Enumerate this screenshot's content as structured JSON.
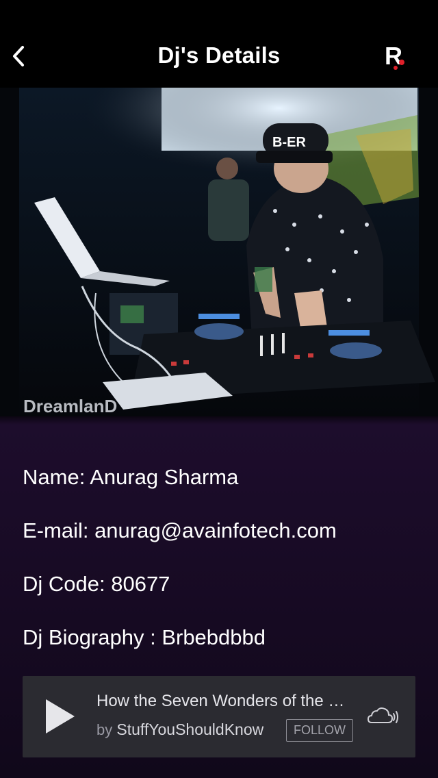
{
  "header": {
    "title": "Dj's Details",
    "back_icon": "chevron-left-icon",
    "logo_icon": "r-logo-icon",
    "logo_letter": "R"
  },
  "photo": {
    "watermark": "DreamlanD",
    "cap_text": "B-ER"
  },
  "details": {
    "name": "Name: Anurag Sharma",
    "email": "E-mail: anurag@avainfotech.com",
    "code": "Dj Code: 80677",
    "biography": "Dj Biography : Brbebdbbd"
  },
  "player": {
    "track_title": "How the Seven Wonders of the World Work",
    "by_label": "by",
    "artist": "StuffYouShouldKnow",
    "follow_label": "FOLLOW",
    "play_icon": "play-icon",
    "cloud_icon": "soundcloud-icon"
  },
  "colors": {
    "background_top": "#000000",
    "background_bottom": "#1d0d2c",
    "player_bg": "#2b2b31",
    "logo_dot": "#e0202a"
  }
}
